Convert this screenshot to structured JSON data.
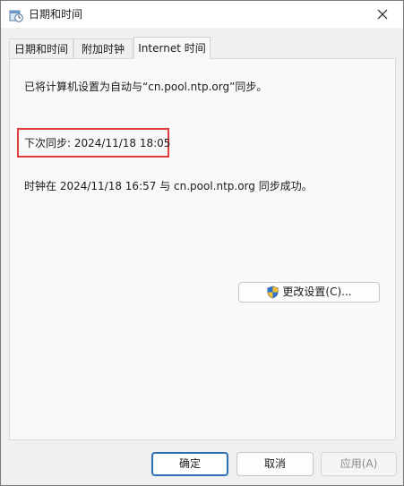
{
  "window": {
    "title": "日期和时间",
    "colors": {
      "accent": "#2d6db7",
      "highlight": "#e23b3b"
    }
  },
  "tabs": [
    {
      "label": "日期和时间"
    },
    {
      "label": "附加时钟"
    },
    {
      "label": "Internet 时间",
      "selected": true
    }
  ],
  "content": {
    "sync_message": "已将计算机设置为自动与“cn.pool.ntp.org”同步。",
    "next_sync": "下次同步: 2024/11/18 18:05",
    "result": "时钟在 2024/11/18 16:57 与 cn.pool.ntp.org 同步成功。",
    "change_button": "更改设置(C)..."
  },
  "buttons": {
    "ok": "确定",
    "cancel": "取消",
    "apply": "应用(A)"
  },
  "icons": {
    "app": "date-time-icon",
    "close": "close-icon",
    "shield": "uac-shield-icon"
  }
}
